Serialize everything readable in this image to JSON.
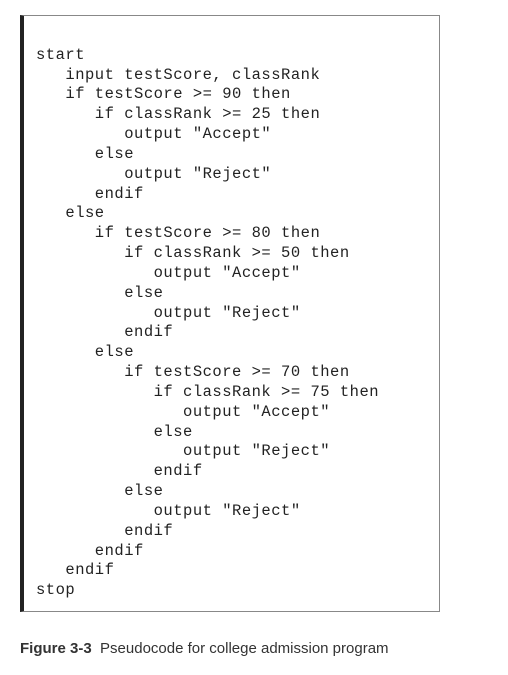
{
  "code": {
    "lines": [
      "start",
      "   input testScore, classRank",
      "   if testScore >= 90 then",
      "      if classRank >= 25 then",
      "         output \"Accept\"",
      "      else",
      "         output \"Reject\"",
      "      endif",
      "   else",
      "      if testScore >= 80 then",
      "         if classRank >= 50 then",
      "            output \"Accept\"",
      "         else",
      "            output \"Reject\"",
      "         endif",
      "      else",
      "         if testScore >= 70 then",
      "            if classRank >= 75 then",
      "               output \"Accept\"",
      "            else",
      "               output \"Reject\"",
      "            endif",
      "         else",
      "            output \"Reject\"",
      "         endif",
      "      endif",
      "   endif",
      "stop"
    ]
  },
  "caption": {
    "label": "Figure 3-3",
    "text": "Pseudocode for college admission program"
  }
}
